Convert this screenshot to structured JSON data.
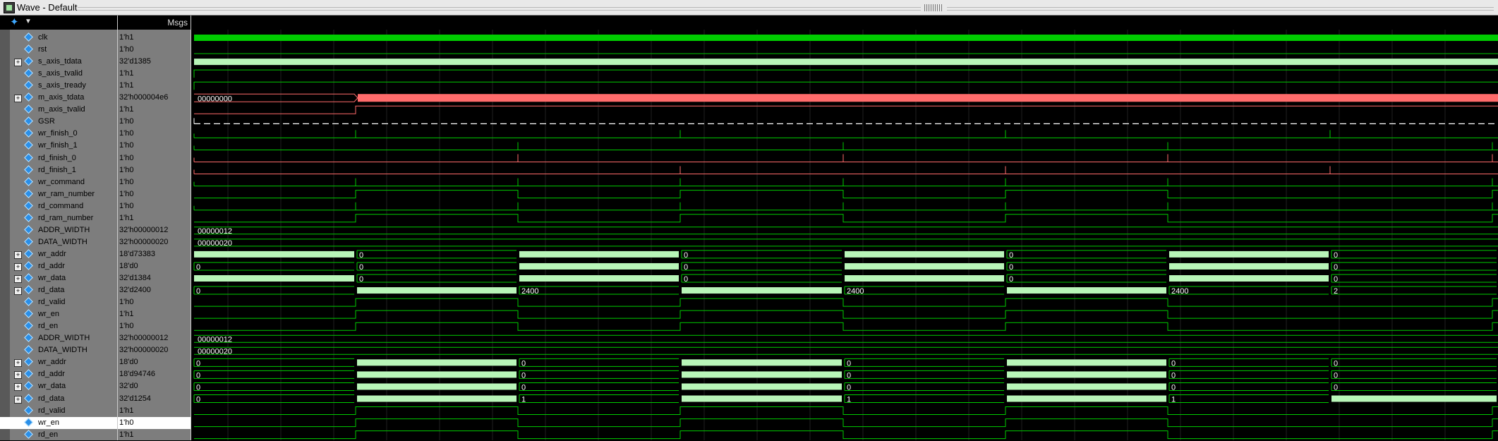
{
  "window": {
    "title": "Wave - Default"
  },
  "header": {
    "msgs_label": "Msgs"
  },
  "selected_row": 32,
  "signals": [
    {
      "name": "clk",
      "value": "1'h1",
      "expandable": false,
      "color": "#00cc00",
      "wave": {
        "kind": "clock"
      }
    },
    {
      "name": "rst",
      "value": "1'h0",
      "expandable": false,
      "color": "#00cc00",
      "wave": {
        "kind": "bit",
        "init": 0,
        "edges": []
      }
    },
    {
      "name": "s_axis_tdata",
      "value": "32'd1385",
      "expandable": true,
      "color": "#00cc00",
      "wave": {
        "kind": "bus",
        "label": ""
      }
    },
    {
      "name": "s_axis_tvalid",
      "value": "1'h1",
      "expandable": false,
      "color": "#00cc00",
      "wave": {
        "kind": "bit",
        "init": 1,
        "edges": []
      }
    },
    {
      "name": "s_axis_tready",
      "value": "1'h1",
      "expandable": false,
      "color": "#00cc00",
      "wave": {
        "kind": "bit",
        "init": 1,
        "edges": []
      }
    },
    {
      "name": "m_axis_tdata",
      "value": "32'h000004e6",
      "expandable": true,
      "color": "#ff6b6b",
      "wave": {
        "kind": "bus",
        "segments": [
          "00000000",
          ""
        ],
        "boundary": "a"
      }
    },
    {
      "name": "m_axis_tvalid",
      "value": "1'h1",
      "expandable": false,
      "color": "#ff6b6b",
      "wave": {
        "kind": "bit",
        "init": 0,
        "edges": [
          "a"
        ]
      }
    },
    {
      "name": "GSR",
      "value": "1'h0",
      "expandable": false,
      "color": "#ffffff",
      "wave": {
        "kind": "dashed"
      }
    },
    {
      "name": "wr_finish_0",
      "value": "1'h0",
      "expandable": false,
      "color": "#00cc00",
      "wave": {
        "kind": "pulse",
        "at": "b"
      }
    },
    {
      "name": "wr_finish_1",
      "value": "1'h0",
      "expandable": false,
      "color": "#00cc00",
      "wave": {
        "kind": "pulse",
        "at": "c"
      }
    },
    {
      "name": "rd_finish_0",
      "value": "1'h0",
      "expandable": false,
      "color": "#ff6b6b",
      "wave": {
        "kind": "pulse",
        "at": "c"
      }
    },
    {
      "name": "rd_finish_1",
      "value": "1'h0",
      "expandable": false,
      "color": "#ff6b6b",
      "wave": {
        "kind": "pulse",
        "at": "b"
      }
    },
    {
      "name": "wr_command",
      "value": "1'h0",
      "expandable": false,
      "color": "#00cc00",
      "wave": {
        "kind": "pulse",
        "at": "a"
      }
    },
    {
      "name": "wr_ram_number",
      "value": "1'h0",
      "expandable": false,
      "color": "#00cc00",
      "wave": {
        "kind": "bit",
        "init": 0,
        "edges": "all"
      }
    },
    {
      "name": "rd_command",
      "value": "1'h0",
      "expandable": false,
      "color": "#00cc00",
      "wave": {
        "kind": "pulse",
        "at": "a"
      }
    },
    {
      "name": "rd_ram_number",
      "value": "1'h1",
      "expandable": false,
      "color": "#00cc00",
      "wave": {
        "kind": "bit",
        "init": 0,
        "edges": "all"
      }
    },
    {
      "name": "ADDR_WIDTH",
      "value": "32'h00000012",
      "expandable": false,
      "color": "#00cc00",
      "wave": {
        "kind": "const",
        "label": "00000012"
      }
    },
    {
      "name": "DATA_WIDTH",
      "value": "32'h00000020",
      "expandable": false,
      "color": "#00cc00",
      "wave": {
        "kind": "const",
        "label": "00000020"
      }
    },
    {
      "name": "wr_addr",
      "value": "18'd73383",
      "expandable": true,
      "color": "#00cc00",
      "wave": {
        "kind": "bus",
        "segments": [
          "",
          "0",
          "",
          "0",
          "",
          "0",
          "",
          "0"
        ]
      }
    },
    {
      "name": "rd_addr",
      "value": "18'd0",
      "expandable": true,
      "color": "#00cc00",
      "wave": {
        "kind": "bus",
        "segments": [
          "0",
          "0",
          "",
          "0",
          "",
          "0",
          "",
          "0"
        ]
      }
    },
    {
      "name": "wr_data",
      "value": "32'd1384",
      "expandable": true,
      "color": "#00cc00",
      "wave": {
        "kind": "bus",
        "segments": [
          "",
          "0",
          "",
          "0",
          "",
          "0",
          "",
          "0"
        ]
      }
    },
    {
      "name": "rd_data",
      "value": "32'd2400",
      "expandable": true,
      "color": "#00cc00",
      "wave": {
        "kind": "bus",
        "segments": [
          "0",
          "",
          "2400",
          "",
          "2400",
          "",
          "2400",
          "2"
        ]
      }
    },
    {
      "name": "rd_valid",
      "value": "1'h0",
      "expandable": false,
      "color": "#00cc00",
      "wave": {
        "kind": "bit",
        "init": 0,
        "edges": "all"
      }
    },
    {
      "name": "wr_en",
      "value": "1'h1",
      "expandable": false,
      "color": "#00cc00",
      "wave": {
        "kind": "bit",
        "init": 0,
        "edges": "all"
      }
    },
    {
      "name": "rd_en",
      "value": "1'h0",
      "expandable": false,
      "color": "#00cc00",
      "wave": {
        "kind": "bit",
        "init": 0,
        "edges": "all"
      }
    },
    {
      "name": "ADDR_WIDTH",
      "value": "32'h00000012",
      "expandable": false,
      "color": "#00cc00",
      "wave": {
        "kind": "const",
        "label": "00000012"
      }
    },
    {
      "name": "DATA_WIDTH",
      "value": "32'h00000020",
      "expandable": false,
      "color": "#00cc00",
      "wave": {
        "kind": "const",
        "label": "00000020"
      }
    },
    {
      "name": "wr_addr",
      "value": "18'd0",
      "expandable": true,
      "color": "#00cc00",
      "wave": {
        "kind": "bus",
        "segments": [
          "0",
          "",
          "0",
          "",
          "0",
          "",
          "0",
          "0"
        ]
      }
    },
    {
      "name": "rd_addr",
      "value": "18'd94746",
      "expandable": true,
      "color": "#00cc00",
      "wave": {
        "kind": "bus",
        "segments": [
          "0",
          "",
          "0",
          "",
          "0",
          "",
          "0",
          "0"
        ]
      }
    },
    {
      "name": "wr_data",
      "value": "32'd0",
      "expandable": true,
      "color": "#00cc00",
      "wave": {
        "kind": "bus",
        "segments": [
          "0",
          "",
          "0",
          "",
          "0",
          "",
          "0",
          "0"
        ]
      }
    },
    {
      "name": "rd_data",
      "value": "32'd1254",
      "expandable": true,
      "color": "#00cc00",
      "wave": {
        "kind": "bus",
        "segments": [
          "0",
          "",
          "1",
          "",
          "1",
          "",
          "1",
          ""
        ]
      }
    },
    {
      "name": "rd_valid",
      "value": "1'h1",
      "expandable": false,
      "color": "#00cc00",
      "wave": {
        "kind": "bit",
        "init": 0,
        "edges": "all"
      }
    },
    {
      "name": "wr_en",
      "value": "1'h0",
      "expandable": false,
      "color": "#00cc00",
      "wave": {
        "kind": "bit",
        "init": 0,
        "edges": "all"
      }
    },
    {
      "name": "rd_en",
      "value": "1'h1",
      "expandable": false,
      "color": "#00cc00",
      "wave": {
        "kind": "bit",
        "init": 0,
        "edges": "all"
      }
    }
  ]
}
